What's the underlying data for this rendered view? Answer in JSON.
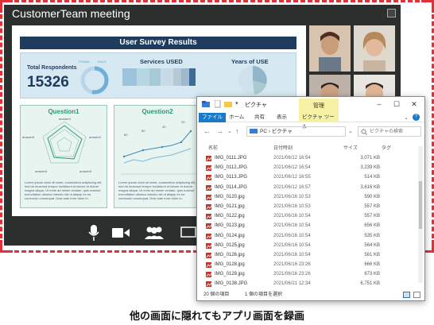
{
  "meeting": {
    "title": "CustomerTeam meeting",
    "presentation": {
      "header": "User Survey Results",
      "respondents_label": "Total Respondents",
      "respondents_value": "15326",
      "gender_female": "FEMAIL",
      "gender_male": "MALE",
      "services_label": "Services USED",
      "years_label": "Years of USE",
      "q1_title": "Question1",
      "q2_title": "Question2",
      "q1_axes": [
        "answer1",
        "answer2",
        "answer3",
        "answer4",
        "answer5"
      ],
      "q2_labels": [
        "80",
        "60",
        "40",
        "20"
      ],
      "lorem": "Lorem ipsum dolor sit amet, consectetur adipiscing elit, sed do eiusmod tempor incididunt ut labore et dolore magna aliqua. Ut enim ad minim veniam, quis nostrud exercitation ullamco laboris nisi ut aliquip ex ea commodo consequat. Duis aute irure dolor in."
    },
    "toolbar_icons": [
      "microphone-icon",
      "camera-icon",
      "participants-icon",
      "screen-share-icon"
    ]
  },
  "explorer": {
    "title": "ピクチャ",
    "manage_tab": "管理",
    "ribbon_tabs": [
      "ファイル",
      "ホーム",
      "共有",
      "表示",
      "ピクチャ ツール"
    ],
    "address": "PC › ピクチャ",
    "search_placeholder": "ピクチャの検索",
    "columns": {
      "name": "名前",
      "date": "日付時刻",
      "size": "サイズ",
      "tag": "タグ"
    },
    "files": [
      {
        "name": "IMG_0111.JPG",
        "date": "2021/06/12 16:54",
        "size": "3,071 KB"
      },
      {
        "name": "IMG_0112.JPG",
        "date": "2021/06/12 16:54",
        "size": "3,239 KB"
      },
      {
        "name": "IMG_0113.JPG",
        "date": "2021/06/12 16:55",
        "size": "514 KB"
      },
      {
        "name": "IMG_0114.JPG",
        "date": "2021/06/12 16:57",
        "size": "3,616 KB"
      },
      {
        "name": "IMG_0120.jpg",
        "date": "2021/06/16 10:53",
        "size": "590 KB"
      },
      {
        "name": "IMG_0121.jpg",
        "date": "2021/06/16 10:53",
        "size": "557 KB"
      },
      {
        "name": "IMG_0122.jpg",
        "date": "2021/06/16 10:54",
        "size": "557 KB"
      },
      {
        "name": "IMG_0123.jpg",
        "date": "2021/06/16 10:54",
        "size": "656 KB"
      },
      {
        "name": "IMG_0124.jpg",
        "date": "2021/06/16 10:54",
        "size": "535 KB"
      },
      {
        "name": "IMG_0125.jpg",
        "date": "2021/06/16 10:54",
        "size": "564 KB"
      },
      {
        "name": "IMG_0126.jpg",
        "date": "2021/06/16 10:54",
        "size": "561 KB"
      },
      {
        "name": "IMG_0128.jpg",
        "date": "2021/06/16 23:26",
        "size": "666 KB"
      },
      {
        "name": "IMG_0129.jpg",
        "date": "2021/06/16 23:26",
        "size": "673 KB"
      },
      {
        "name": "IMG_0138.JPG",
        "date": "2021/06/21 12:34",
        "size": "6,751 KB"
      }
    ],
    "status_count": "20 個の項目",
    "status_selected": "1 個の項目を選択"
  },
  "caption": "他の画面に隠れてもアプリ画面を録画",
  "colors": {
    "record_frame": "#e0303a",
    "header": "#1f3c5f",
    "accent": "#2a9a72",
    "file_tab": "#1979ca",
    "manage_tab": "#f7f1a6"
  }
}
